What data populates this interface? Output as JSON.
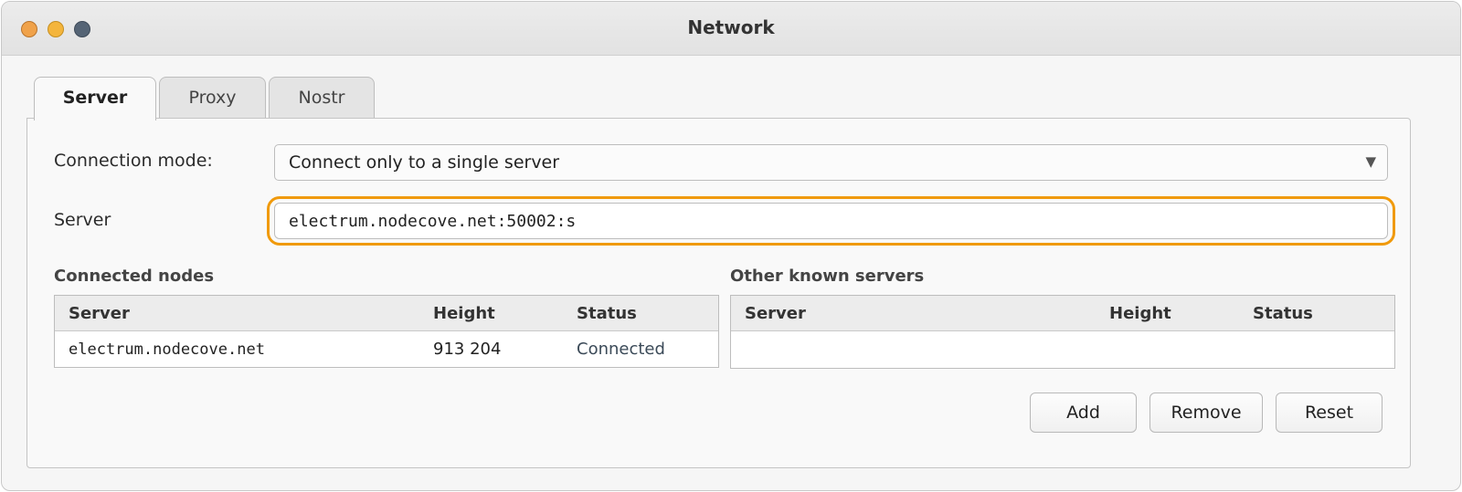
{
  "window": {
    "title": "Network",
    "controls": [
      "close",
      "minimize",
      "maximize"
    ]
  },
  "tabs": [
    {
      "label": "Server",
      "active": true
    },
    {
      "label": "Proxy",
      "active": false
    },
    {
      "label": "Nostr",
      "active": false
    }
  ],
  "server_tab": {
    "connection_mode_label": "Connection mode:",
    "connection_mode_value": "Connect only to a single server",
    "server_label": "Server",
    "server_value": "electrum.nodecove.net:50002:s",
    "connected_nodes": {
      "title": "Connected nodes",
      "columns": [
        "Server",
        "Height",
        "Status"
      ],
      "rows": [
        {
          "server": "electrum.nodecove.net",
          "height": "913 204",
          "status": "Connected"
        }
      ]
    },
    "other_servers": {
      "title": "Other known servers",
      "columns": [
        "Server",
        "Height",
        "Status"
      ],
      "rows": []
    },
    "buttons": {
      "add": "Add",
      "remove": "Remove",
      "reset": "Reset"
    }
  },
  "colors": {
    "focus_ring": "#f09a0c",
    "status_connected": "#3b4a58"
  }
}
